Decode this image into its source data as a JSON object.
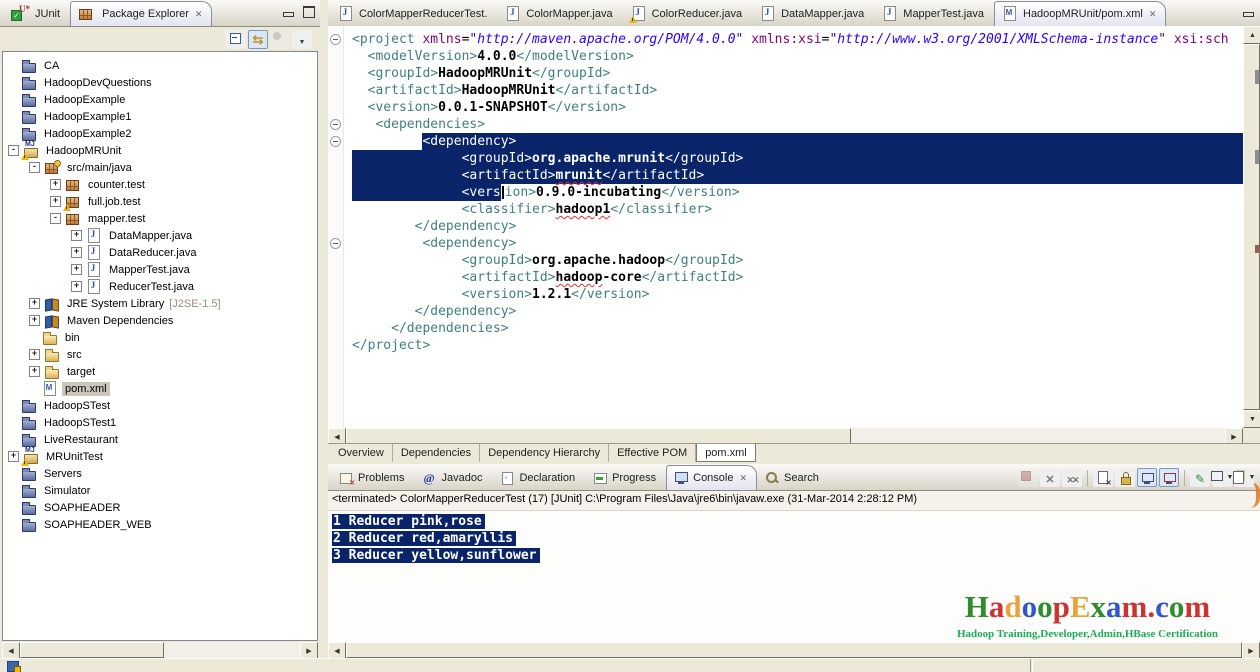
{
  "colors": {
    "selection": "#0a246a",
    "chrome": "#ece9d8",
    "tag": "#3f7f7f",
    "attr": "#7f007f",
    "attr_value": "#2a00ff",
    "subtitle_green": "#1faa59"
  },
  "left_panel": {
    "tabs": [
      {
        "label": "JUnit",
        "icon": "junit",
        "active": false
      },
      {
        "label": "Package Explorer",
        "icon": "package",
        "active": true,
        "closable": true
      }
    ],
    "toolbar": [
      {
        "name": "collapse-all",
        "title": "Collapse All"
      },
      {
        "name": "link-with-editor",
        "title": "Link with Editor",
        "pressed": true
      },
      {
        "name": "focus",
        "title": "Focus",
        "disabled": true
      },
      {
        "name": "view-menu",
        "title": "View Menu"
      }
    ],
    "tree": [
      {
        "level": 0,
        "expand": null,
        "icon": "folder-navy",
        "label": "CA"
      },
      {
        "level": 0,
        "expand": null,
        "icon": "folder-navy",
        "label": "HadoopDevQuestions"
      },
      {
        "level": 0,
        "expand": null,
        "icon": "folder-navy",
        "label": "HadoopExample"
      },
      {
        "level": 0,
        "expand": null,
        "icon": "folder-navy",
        "label": "HadoopExample1"
      },
      {
        "level": 0,
        "expand": null,
        "icon": "folder-navy",
        "label": "HadoopExample2"
      },
      {
        "level": 0,
        "expand": "minus",
        "icon": "mvnproj",
        "warn": true,
        "label": "HadoopMRUnit"
      },
      {
        "level": 1,
        "expand": "minus",
        "icon": "srcpkg",
        "label": "src/main/java"
      },
      {
        "level": 2,
        "expand": "plus",
        "icon": "package",
        "label": "counter.test"
      },
      {
        "level": 2,
        "expand": "plus",
        "icon": "package",
        "warn": true,
        "label": "full.job.test"
      },
      {
        "level": 2,
        "expand": "minus",
        "icon": "package",
        "label": "mapper.test"
      },
      {
        "level": 3,
        "expand": "plus",
        "icon": "jfile",
        "label": "DataMapper.java"
      },
      {
        "level": 3,
        "expand": "plus",
        "icon": "jfile",
        "label": "DataReducer.java"
      },
      {
        "level": 3,
        "expand": "plus",
        "icon": "jfile",
        "label": "MapperTest.java"
      },
      {
        "level": 3,
        "expand": "plus",
        "icon": "jfile",
        "label": "ReducerTest.java"
      },
      {
        "level": 1,
        "expand": "plus",
        "icon": "library",
        "label": "JRE System Library",
        "suffix": "[J2SE-1.5]"
      },
      {
        "level": 1,
        "expand": "plus",
        "icon": "library",
        "label": "Maven Dependencies"
      },
      {
        "level": 1,
        "expand": null,
        "icon": "folder-yellow",
        "label": "bin"
      },
      {
        "level": 1,
        "expand": "plus",
        "icon": "folder-yellow",
        "label": "src"
      },
      {
        "level": 1,
        "expand": "plus",
        "icon": "folder-yellow",
        "label": "target"
      },
      {
        "level": 1,
        "expand": null,
        "icon": "mfile",
        "label": "pom.xml",
        "selected": true
      },
      {
        "level": 0,
        "expand": null,
        "icon": "folder-navy",
        "label": "HadoopSTest"
      },
      {
        "level": 0,
        "expand": null,
        "icon": "folder-navy",
        "label": "HadoopSTest1"
      },
      {
        "level": 0,
        "expand": null,
        "icon": "folder-navy",
        "label": "LiveRestaurant"
      },
      {
        "level": 0,
        "expand": "plus",
        "icon": "mvnproj",
        "warn": true,
        "label": "MRUnitTest"
      },
      {
        "level": 0,
        "expand": null,
        "icon": "folder-navy",
        "label": "Servers"
      },
      {
        "level": 0,
        "expand": null,
        "icon": "folder-navy",
        "label": "Simulator"
      },
      {
        "level": 0,
        "expand": null,
        "icon": "folder-navy",
        "label": "SOAPHEADER"
      },
      {
        "level": 0,
        "expand": null,
        "icon": "folder-navy",
        "label": "SOAPHEADER_WEB"
      }
    ]
  },
  "editor": {
    "tabs": [
      {
        "label": "ColorMapperReducerTest.",
        "icon": "jfile"
      },
      {
        "label": "ColorMapper.java",
        "icon": "jfile"
      },
      {
        "label": "ColorReducer.java",
        "icon": "jfile",
        "warn": true
      },
      {
        "label": "DataMapper.java",
        "icon": "jfile"
      },
      {
        "label": "MapperTest.java",
        "icon": "jfile"
      },
      {
        "label": "HadoopMRUnit/pom.xml",
        "icon": "mfile",
        "active": true,
        "closable": true
      }
    ],
    "fold_lines": [
      0,
      5,
      6,
      12
    ],
    "code_lines": [
      {
        "indent": 0,
        "segments": [
          {
            "t": "<project ",
            "c": "tag"
          },
          {
            "t": "xmlns",
            "c": "attr"
          },
          {
            "t": "=",
            "c": "pln"
          },
          {
            "t": "\"http://maven.apache.org/POM/4.0.0\"",
            "c": "aval"
          },
          {
            "t": " ",
            "c": "pln"
          },
          {
            "t": "xmlns:xsi",
            "c": "attr"
          },
          {
            "t": "=",
            "c": "pln"
          },
          {
            "t": "\"http://www.w3.org/2001/XMLSchema-instance\"",
            "c": "aval"
          },
          {
            "t": " ",
            "c": "pln"
          },
          {
            "t": "xsi:sch",
            "c": "attr"
          }
        ]
      },
      {
        "indent": 2,
        "segments": [
          {
            "t": "<modelVersion>",
            "c": "tag"
          },
          {
            "t": "4.0.0",
            "c": "txt"
          },
          {
            "t": "</modelVersion>",
            "c": "tag"
          }
        ]
      },
      {
        "indent": 2,
        "segments": [
          {
            "t": "<groupId>",
            "c": "tag"
          },
          {
            "t": "HadoopMRUnit",
            "c": "txt"
          },
          {
            "t": "</groupId>",
            "c": "tag"
          }
        ]
      },
      {
        "indent": 2,
        "segments": [
          {
            "t": "<artifactId>",
            "c": "tag"
          },
          {
            "t": "HadoopMRUnit",
            "c": "txt"
          },
          {
            "t": "</artifactId>",
            "c": "tag"
          }
        ]
      },
      {
        "indent": 2,
        "segments": [
          {
            "t": "<version>",
            "c": "tag"
          },
          {
            "t": "0.0.1-SNAPSHOT",
            "c": "txt"
          },
          {
            "t": "</version>",
            "c": "tag"
          }
        ]
      },
      {
        "indent": 3,
        "segments": [
          {
            "t": "<dependencies>",
            "c": "tag"
          }
        ]
      },
      {
        "indent": 9,
        "selFill": true,
        "segments": [
          {
            "t": "<dependency>",
            "c": "tag",
            "sel": true
          }
        ]
      },
      {
        "indent": 14,
        "selIndent": true,
        "selFill": true,
        "segments": [
          {
            "t": "<groupId>",
            "c": "tag",
            "sel": true
          },
          {
            "t": "org.apache.mrunit",
            "c": "txt",
            "sel": true
          },
          {
            "t": "</groupId>",
            "c": "tag",
            "sel": true
          }
        ]
      },
      {
        "indent": 14,
        "selIndent": true,
        "selFill": true,
        "segments": [
          {
            "t": "<artifactId>",
            "c": "tag",
            "sel": true
          },
          {
            "t": "mrunit",
            "c": "txt",
            "sel": true,
            "sq": true
          },
          {
            "t": "</artifactId>",
            "c": "tag",
            "sel": true
          }
        ]
      },
      {
        "indent": 14,
        "selIndent": true,
        "cursorAfter": 0,
        "segments": [
          {
            "t": "<vers",
            "c": "tag",
            "sel": true
          },
          {
            "t": "ion>",
            "c": "tag"
          },
          {
            "t": "0.9.0-incubating",
            "c": "txt"
          },
          {
            "t": "</version>",
            "c": "tag"
          }
        ]
      },
      {
        "indent": 14,
        "segments": [
          {
            "t": "<classifier>",
            "c": "tag"
          },
          {
            "t": "hadoop1",
            "c": "txt",
            "sq": true
          },
          {
            "t": "</classifier>",
            "c": "tag"
          }
        ]
      },
      {
        "indent": 8,
        "segments": [
          {
            "t": "</dependency>",
            "c": "tag"
          }
        ]
      },
      {
        "indent": 9,
        "segments": [
          {
            "t": "<dependency>",
            "c": "tag"
          }
        ]
      },
      {
        "indent": 14,
        "segments": [
          {
            "t": "<groupId>",
            "c": "tag"
          },
          {
            "t": "org.apache.hadoop",
            "c": "txt"
          },
          {
            "t": "</groupId>",
            "c": "tag"
          }
        ]
      },
      {
        "indent": 14,
        "segments": [
          {
            "t": "<artifactId>",
            "c": "tag"
          },
          {
            "t": "hadoop",
            "c": "txt",
            "sq": true
          },
          {
            "t": "-core",
            "c": "txt"
          },
          {
            "t": "</artifactId>",
            "c": "tag"
          }
        ]
      },
      {
        "indent": 14,
        "segments": [
          {
            "t": "<version>",
            "c": "tag"
          },
          {
            "t": "1.2.1",
            "c": "txt"
          },
          {
            "t": "</version>",
            "c": "tag"
          }
        ]
      },
      {
        "indent": 8,
        "segments": [
          {
            "t": "</dependency>",
            "c": "tag"
          }
        ]
      },
      {
        "indent": 5,
        "segments": [
          {
            "t": "</dependencies>",
            "c": "tag"
          }
        ]
      },
      {
        "indent": 0,
        "segments": [
          {
            "t": "</project>",
            "c": "tag"
          }
        ]
      }
    ],
    "bottom_tabs": [
      {
        "label": "Overview"
      },
      {
        "label": "Dependencies"
      },
      {
        "label": "Dependency Hierarchy"
      },
      {
        "label": "Effective POM"
      },
      {
        "label": "pom.xml",
        "active": true
      }
    ]
  },
  "console": {
    "tabs": [
      {
        "label": "Problems",
        "icon": "problems"
      },
      {
        "label": "Javadoc",
        "icon": "javadoc"
      },
      {
        "label": "Declaration",
        "icon": "declaration"
      },
      {
        "label": "Progress",
        "icon": "progress"
      },
      {
        "label": "Console",
        "icon": "console-t",
        "active": true,
        "closable": true
      },
      {
        "label": "Search",
        "icon": "search"
      }
    ],
    "toolbar": [
      {
        "name": "terminate",
        "title": "Terminate",
        "disabled": true
      },
      {
        "name": "remove-launch",
        "title": "Remove Launch"
      },
      {
        "name": "remove-all-terminated",
        "title": "Remove All Terminated Launches"
      },
      {
        "sep": true
      },
      {
        "name": "clear-console",
        "title": "Clear Console"
      },
      {
        "name": "scroll-lock",
        "title": "Scroll Lock"
      },
      {
        "name": "show-stdout",
        "title": "Show Console When Standard Out Changes",
        "pressed": true
      },
      {
        "name": "show-stderr",
        "title": "Show Console When Standard Error Changes",
        "pressed": true
      },
      {
        "sep": true
      },
      {
        "name": "pin-console",
        "title": "Pin Console"
      },
      {
        "name": "display-selected-console",
        "title": "Display Selected Console",
        "dropdown": true
      },
      {
        "name": "open-console",
        "title": "Open Console",
        "dropdown": true
      }
    ],
    "status_line": "<terminated> ColorMapperReducerTest (17) [JUnit] C:\\Program Files\\Java\\jre6\\bin\\javaw.exe (31-Mar-2014 2:28:12 PM)",
    "output_lines": [
      "1 Reducer pink,rose",
      "2 Reducer red,amaryllis",
      "3 Reducer yellow,sunflower"
    ]
  },
  "watermark": {
    "title": "HadoopExam.com",
    "letter_colors": [
      "#2e8b2e",
      "#cc3333",
      "#e8a33d",
      "#3355cc",
      "#2e8b2e",
      "#cc3333",
      "#e8a33d",
      "#2e8b2e",
      "#3355cc",
      "#cc3333",
      "#cc3333",
      "#3355cc",
      "#2e8b2e",
      "#cc3333"
    ],
    "subtitle": "Hadoop Training,Developer,Admin,HBase Certification"
  }
}
